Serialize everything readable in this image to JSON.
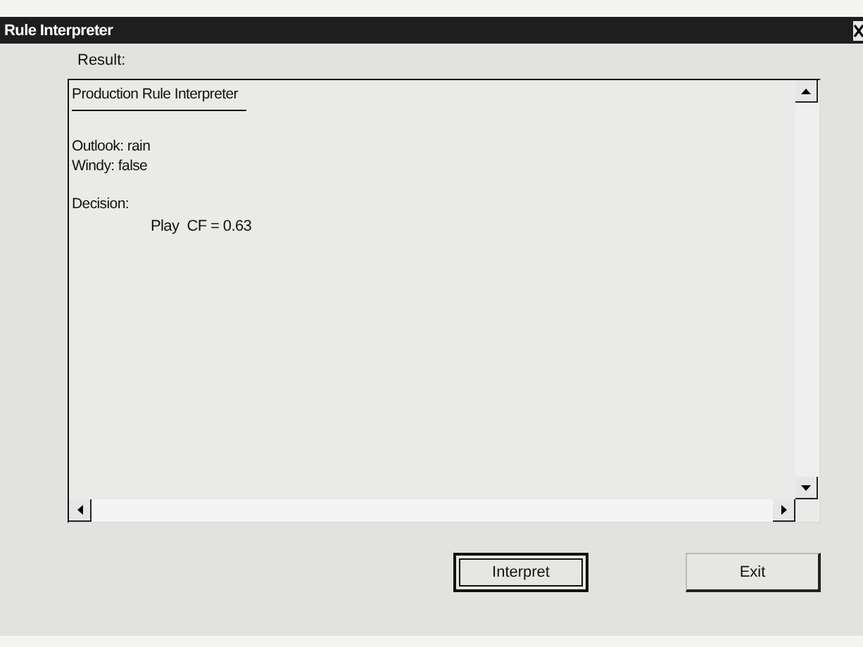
{
  "window": {
    "title": "Rule Interpreter"
  },
  "result": {
    "label": "Result:",
    "heading": "Production Rule Interpreter",
    "facts": [
      "Outlook: rain",
      "Windy: false"
    ],
    "decision_label": "Decision:",
    "decision": "Play  CF = 0.63"
  },
  "buttons": [
    {
      "label": "Interpret",
      "default": true
    },
    {
      "label": "Exit",
      "default": false
    }
  ]
}
